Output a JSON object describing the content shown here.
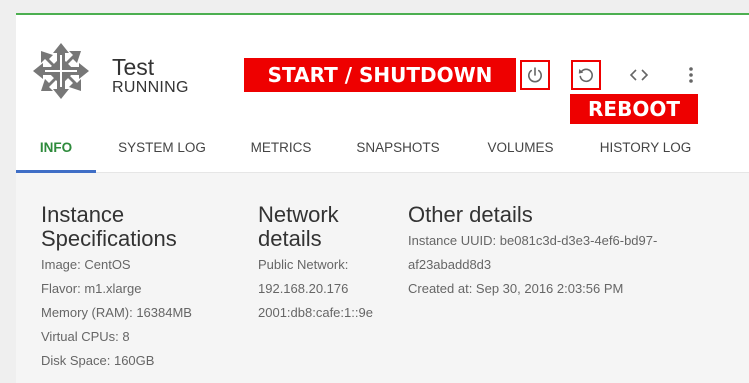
{
  "instance": {
    "name": "Test",
    "status": "RUNNING"
  },
  "annotations": {
    "start_shutdown": "START / SHUTDOWN",
    "reboot": "REBOOT"
  },
  "actions": {
    "icons": [
      "power-icon",
      "reboot-icon",
      "code-icon",
      "more-vertical-icon"
    ]
  },
  "tabs": [
    {
      "label": "INFO",
      "active": true
    },
    {
      "label": "SYSTEM LOG",
      "active": false
    },
    {
      "label": "METRICS",
      "active": false
    },
    {
      "label": "SNAPSHOTS",
      "active": false
    },
    {
      "label": "VOLUMES",
      "active": false
    },
    {
      "label": "HISTORY LOG",
      "active": false
    }
  ],
  "sections": {
    "specs": {
      "title_line1": "Instance",
      "title_line2": "Specifications",
      "lines": [
        "Image: CentOS",
        "Flavor: m1.xlarge",
        "Memory (RAM): 16384MB",
        "Virtual CPUs: 8",
        "Disk Space: 160GB"
      ]
    },
    "network": {
      "title_line1": "Network",
      "title_line2": "details",
      "lines": [
        "Public Network:",
        "192.168.20.176",
        "2001:db8:cafe:1::9e"
      ]
    },
    "other": {
      "title": "Other details",
      "lines": [
        "Instance UUID: be081c3d-d3e3-4ef6-bd97-",
        "af23abadd8d3",
        "Created at: Sep 30, 2016 2:03:56 PM"
      ]
    }
  },
  "colors": {
    "accent_green": "#4caf50",
    "active_tab_text": "#2e8b3c",
    "active_tab_underline": "#3f6ec6",
    "callout_red": "#ee0000"
  }
}
